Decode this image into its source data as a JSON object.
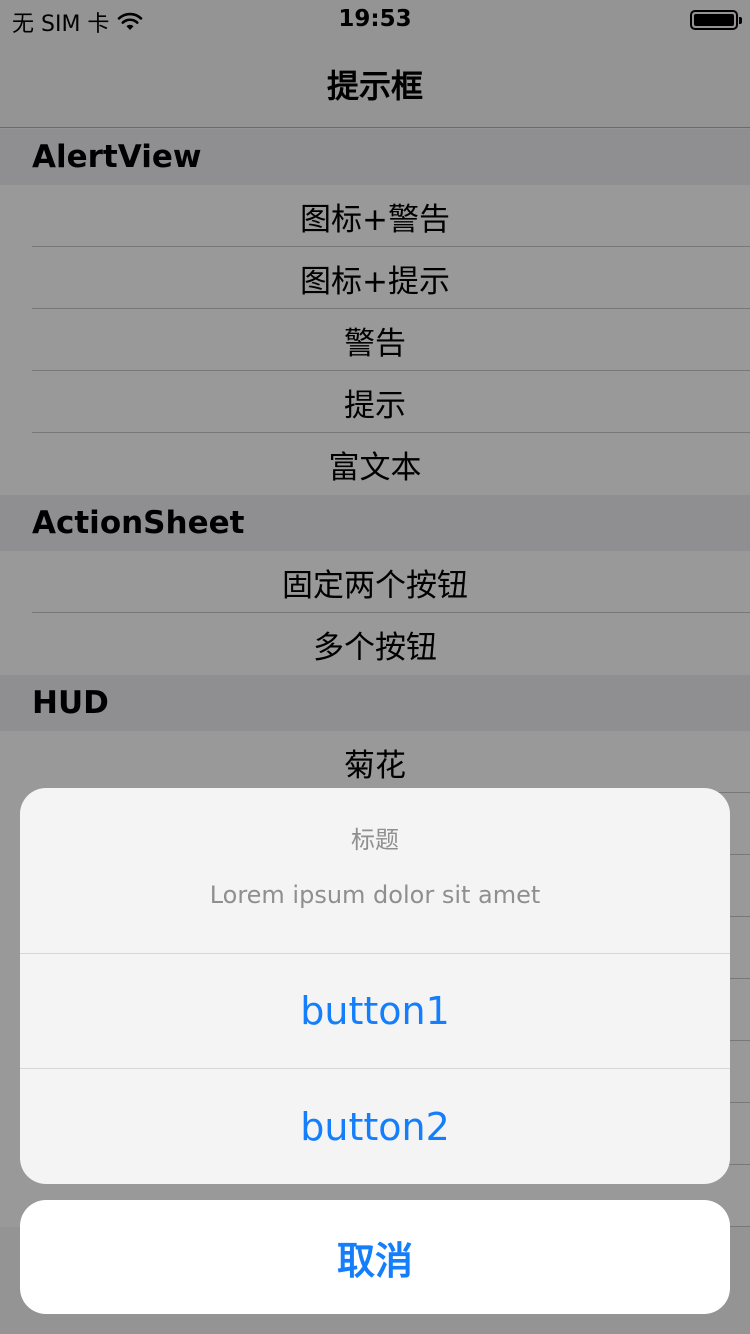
{
  "status_bar": {
    "carrier": "无 SIM 卡",
    "time": "19:53",
    "battery_level": 1.0
  },
  "nav": {
    "title": "提示框"
  },
  "sections": [
    {
      "header": "AlertView",
      "items": [
        "图标+警告",
        "图标+提示",
        "警告",
        "提示",
        "富文本"
      ]
    },
    {
      "header": "ActionSheet",
      "items": [
        "固定两个按钮",
        "多个按钮"
      ]
    },
    {
      "header": "HUD",
      "items": [
        "菊花",
        "",
        "",
        "",
        "",
        "",
        "",
        ""
      ]
    }
  ],
  "action_sheet": {
    "title": "标题",
    "message": "Lorem ipsum dolor sit amet",
    "buttons": [
      "button1",
      "button2"
    ],
    "cancel": "取消"
  },
  "colors": {
    "accent": "#157efb",
    "overlay": "rgba(0,0,0,0.4)",
    "section_bg": "#efeff4"
  },
  "icons": [
    "wifi-icon",
    "battery-icon"
  ]
}
